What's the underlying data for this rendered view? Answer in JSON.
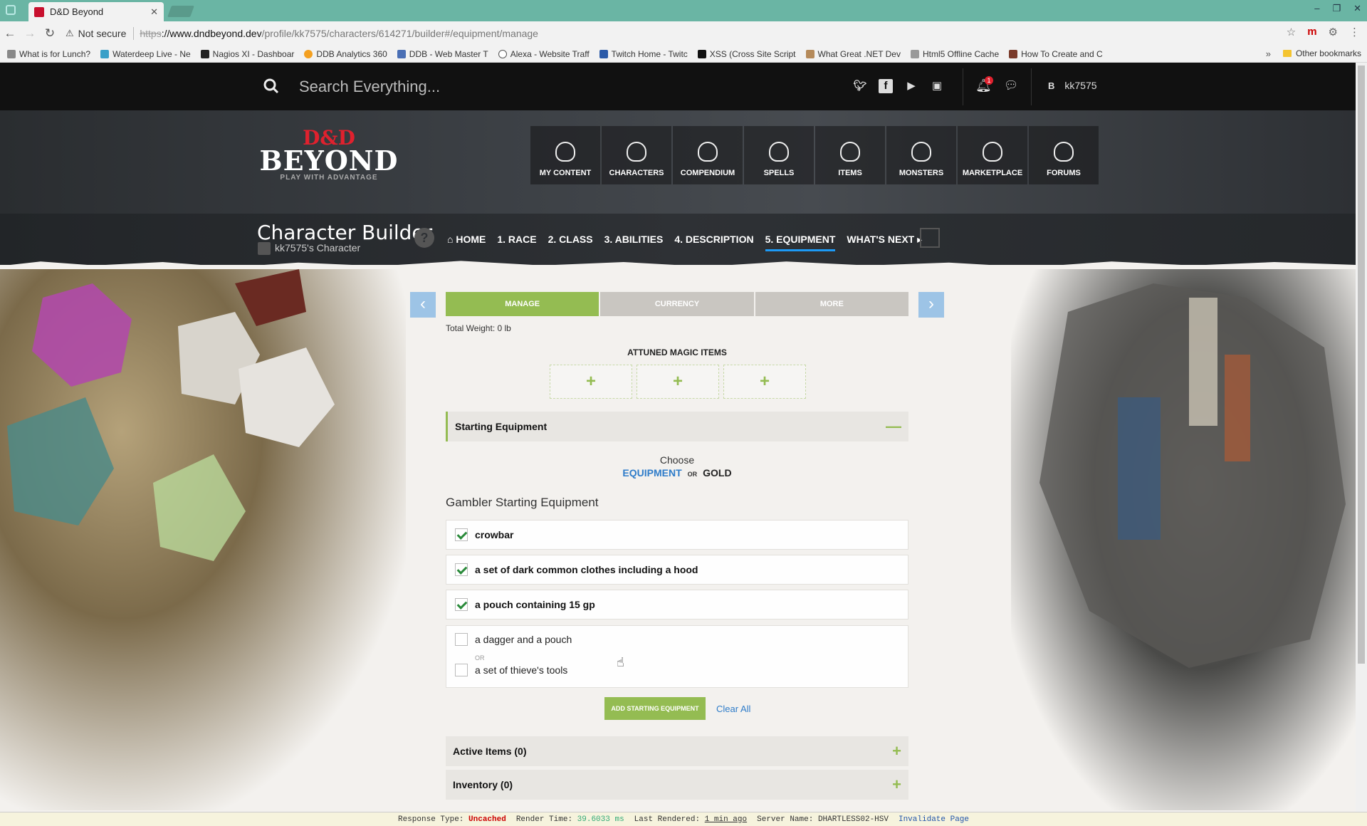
{
  "browser": {
    "tab_title": "D&D Beyond",
    "tab_close": "✕",
    "security_label": "Not secure",
    "url_scheme": "https",
    "url_host": "://www.dndbeyond.dev",
    "url_path": "/profile/kk7575/characters/614271/builder#/equipment/manage",
    "bookmarks": [
      "What is for Lunch?",
      "Waterdeep Live - Ne",
      "Nagios XI - Dashboar",
      "DDB Analytics 360",
      "DDB - Web Master T",
      "Alexa - Website Traff",
      "Twitch Home - Twitc",
      "XSS (Cross Site Script",
      "What Great .NET Dev",
      "Html5 Offline Cache",
      "How To Create and C"
    ],
    "bookmarks_more": "»",
    "other_bookmarks": "Other bookmarks"
  },
  "header": {
    "search_placeholder": "Search Everything...",
    "notification_count": "1",
    "user_initial": "B",
    "username": "kk7575"
  },
  "logo": {
    "mark": "D&D",
    "name": "BEYOND",
    "tagline": "PLAY WITH ADVANTAGE"
  },
  "main_nav": [
    {
      "label": "MY CONTENT"
    },
    {
      "label": "CHARACTERS"
    },
    {
      "label": "COMPENDIUM"
    },
    {
      "label": "SPELLS"
    },
    {
      "label": "ITEMS"
    },
    {
      "label": "MONSTERS"
    },
    {
      "label": "MARKETPLACE"
    },
    {
      "label": "FORUMS"
    }
  ],
  "builder": {
    "title": "Character Builder",
    "subtitle": "kk7575's Character",
    "help": "?",
    "steps": [
      "⌂ HOME",
      "1. RACE",
      "2. CLASS",
      "3. ABILITIES",
      "4. DESCRIPTION",
      "5. EQUIPMENT",
      "WHAT'S NEXT ▸"
    ],
    "active_step": 5
  },
  "equipment": {
    "subtabs": [
      "MANAGE",
      "CURRENCY",
      "MORE"
    ],
    "total_weight": "Total Weight: 0 lb",
    "attuned_title": "ATTUNED MAGIC ITEMS",
    "attuned_slot_symbol": "+",
    "starting_section": "Starting Equipment",
    "collapse_symbol": "—",
    "choose_label": "Choose",
    "choose_equipment": "EQUIPMENT",
    "choose_or": "OR",
    "choose_gold": "GOLD",
    "group_title": "Gambler Starting Equipment",
    "items": [
      {
        "label": "crowbar",
        "checked": true
      },
      {
        "label": "a set of dark common clothes including a hood",
        "checked": true
      },
      {
        "label": "a pouch containing 15 gp",
        "checked": true
      }
    ],
    "choice": {
      "option_a": "a dagger and a pouch",
      "or": "OR",
      "option_b": "a set of thieve's tools"
    },
    "add_button": "ADD STARTING EQUIPMENT",
    "clear_all": "Clear All",
    "active_items": "Active Items (0)",
    "inventory": "Inventory (0)",
    "expand_symbol": "+"
  },
  "status": {
    "response_label": "Response Type:",
    "response_value": "Uncached",
    "render_label": "Render Time:",
    "render_value": "39.6033 ms",
    "last_label": "Last Rendered:",
    "last_value": "1 min ago",
    "server_label": "Server Name:",
    "server_value": "DHARTLESS02-HSV",
    "invalidate": "Invalidate Page"
  }
}
